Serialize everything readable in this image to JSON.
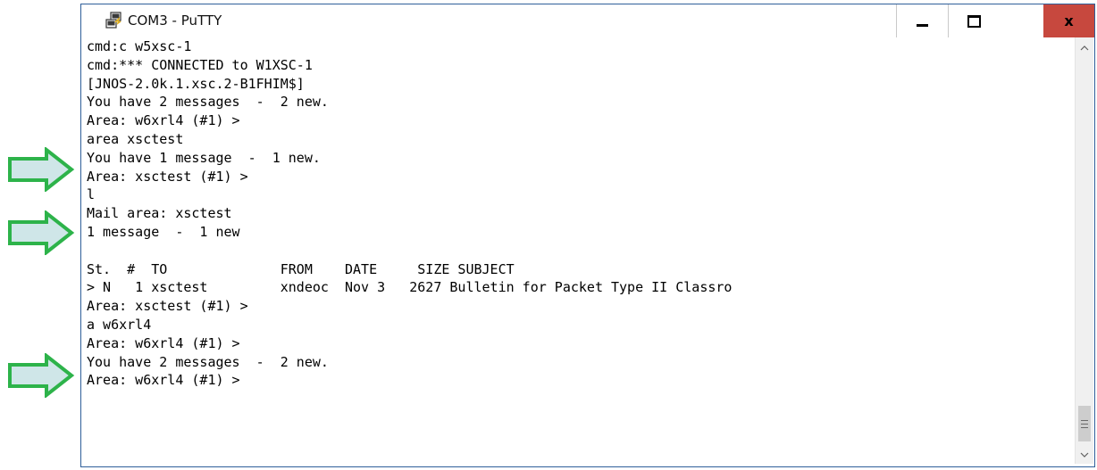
{
  "window": {
    "title": "COM3 - PuTTY",
    "controls": {
      "minimize": "minimize",
      "maximize": "maximize",
      "close": "x"
    }
  },
  "terminal": {
    "lines": [
      "cmd:c w5xsc-1",
      "cmd:*** CONNECTED to W1XSC-1",
      "[JNOS-2.0k.1.xsc.2-B1FHIM$]",
      "You have 2 messages  -  2 new.",
      "Area: w6xrl4 (#1) >",
      "area xsctest",
      "You have 1 message  -  1 new.",
      "Area: xsctest (#1) >",
      "l",
      "Mail area: xsctest",
      "1 message  -  1 new",
      "",
      "St.  #  TO              FROM    DATE     SIZE SUBJECT",
      "> N   1 xsctest         xndeoc  Nov 3   2627 Bulletin for Packet Type II Classro",
      "Area: xsctest (#1) >",
      "a w6xrl4",
      "Area: w6xrl4 (#1) >",
      "You have 2 messages  -  2 new.",
      "Area: w6xrl4 (#1) >"
    ]
  },
  "scrollbar": {
    "up_glyph": "^",
    "down_glyph": "v",
    "thumb_glyph": "≡"
  },
  "annotations": {
    "arrow_color": "#2db34a",
    "arrow_fill": "#cfe6e8",
    "arrow_count": 3
  },
  "colors": {
    "close_button": "#c7483e",
    "window_border": "#2f5f9a",
    "terminal_bg": "#ffffff",
    "terminal_fg": "#000000"
  }
}
